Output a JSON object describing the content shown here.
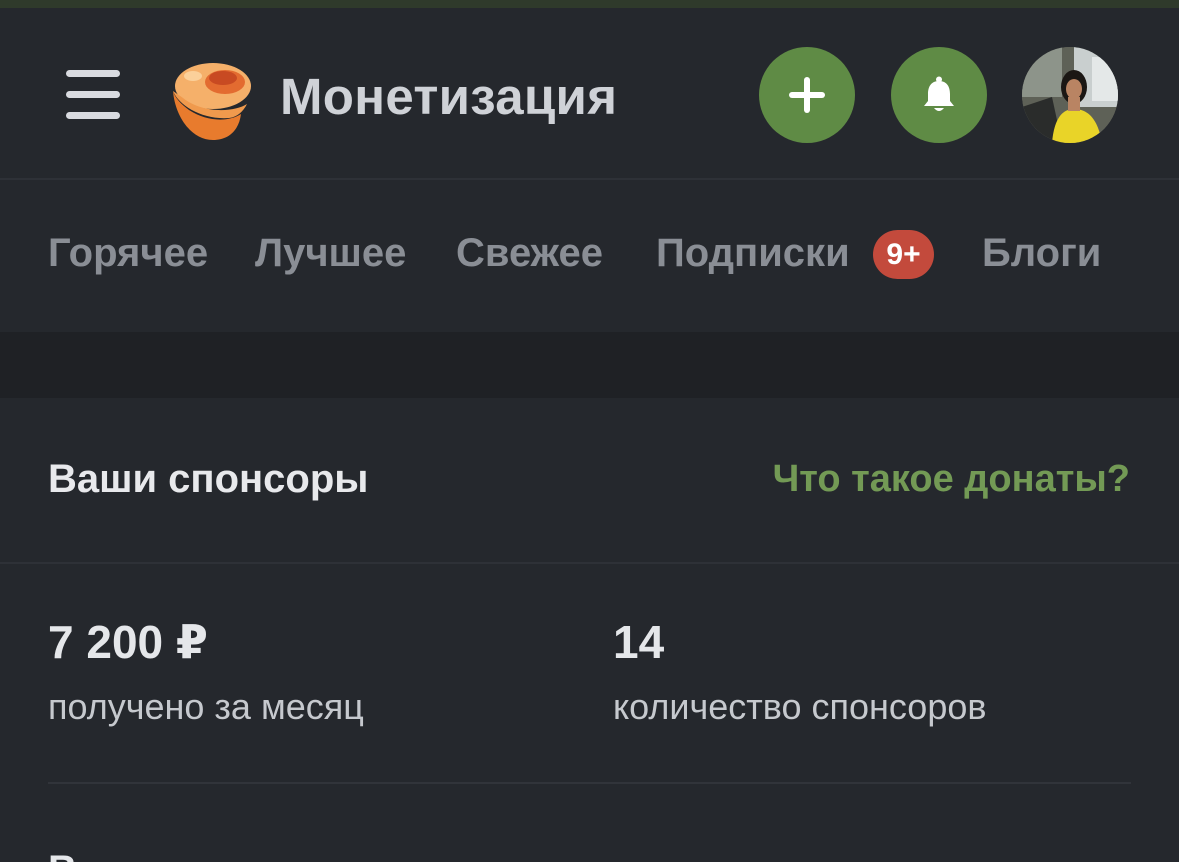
{
  "header": {
    "title": "Монетизация",
    "menu_icon": "hamburger-menu-icon",
    "logo_icon": "pikabu-logo-icon",
    "add_icon": "plus-icon",
    "bell_icon": "bell-icon",
    "accent_color": "#5f8b45"
  },
  "tabs": [
    {
      "label": "Горячее"
    },
    {
      "label": "Лучшее"
    },
    {
      "label": "Свежее"
    },
    {
      "label": "Подписки",
      "badge": "9+"
    },
    {
      "label": "Блоги"
    }
  ],
  "section": {
    "title": "Ваши спонсоры",
    "link": "Что такое донаты?"
  },
  "stats": {
    "received": {
      "value": "7 200 ₽",
      "label": "получено за месяц"
    },
    "sponsors": {
      "value": "14",
      "label": "количество спонсоров"
    }
  },
  "footer": {
    "cut_text": "В"
  }
}
